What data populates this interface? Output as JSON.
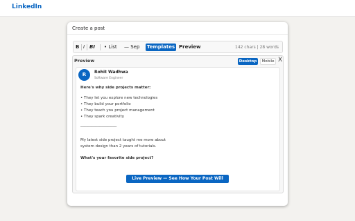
{
  "header": {
    "brand": "LinkedIn"
  },
  "dialog": {
    "title": "Create a post",
    "toolbar": {
      "bold": "B",
      "italic": "I",
      "bold_italic": "BI",
      "list": "• List",
      "separator": "— Sep",
      "templates": "Templates",
      "preview": "Preview",
      "stats": "142 chars | 28 words"
    },
    "preview": {
      "title": "Preview",
      "desktop": "Desktop",
      "mobile": "Mobile",
      "close": "X",
      "post": {
        "avatar_initial": "R",
        "author": "Rohit Wadhwa",
        "headline": "Software Engineer",
        "heading": "Here's why side projects matter:",
        "bullets": [
          "• They let you explore new technologies",
          "• They build your portfolio",
          "• They teach you project management",
          "• They spark creativity"
        ],
        "divider": "___________________",
        "paragraph": [
          "My latest side project taught me more about",
          "system design than 2 years of tutorials."
        ],
        "question": "What's your favorite side project?"
      }
    },
    "live_button": "Live Preview — See How Your Post Will Look"
  }
}
